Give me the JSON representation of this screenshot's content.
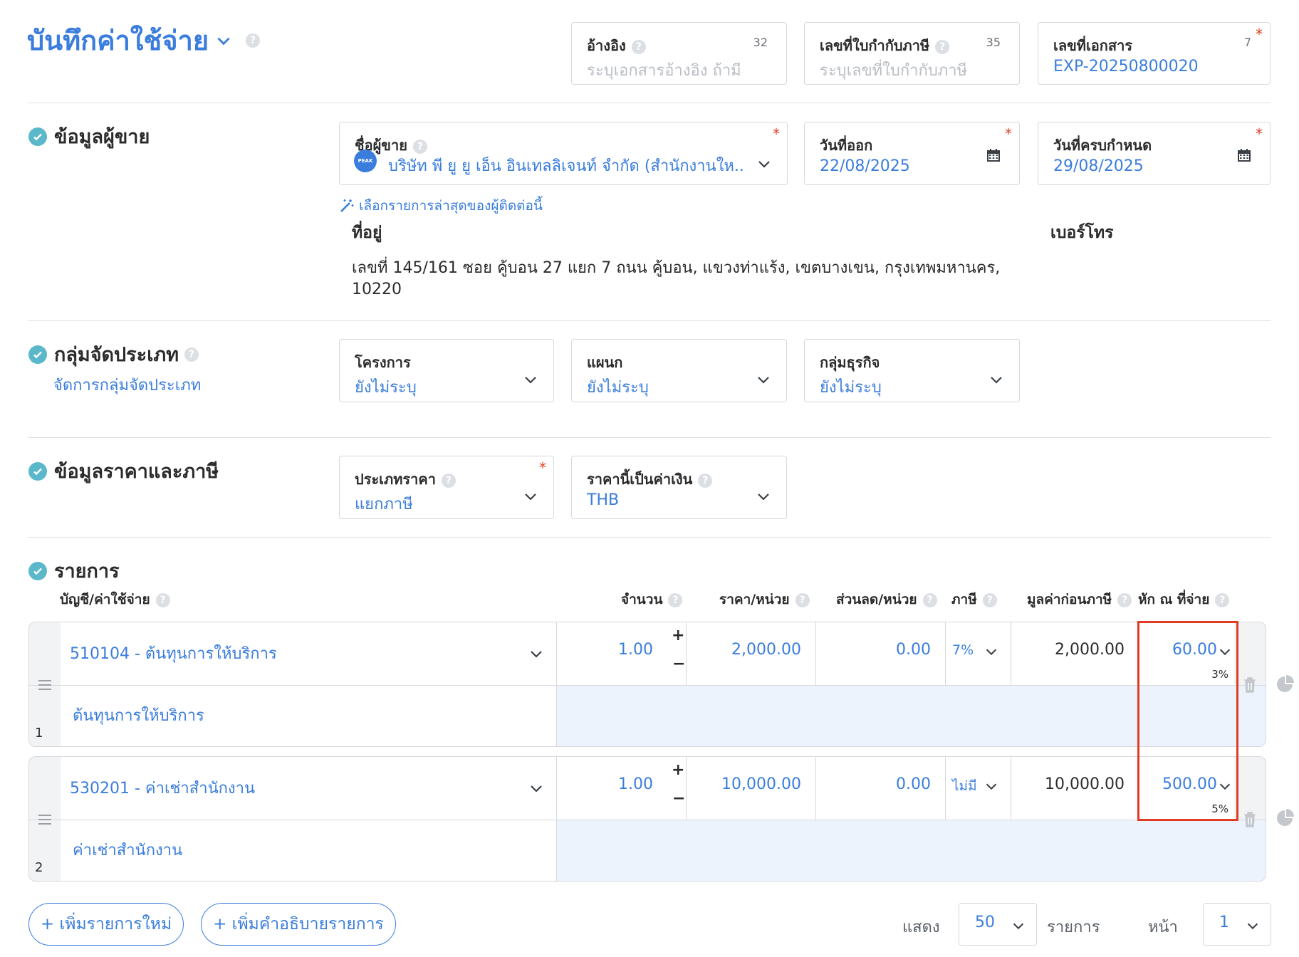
{
  "header": {
    "title": "บันทึกค่าใช้จ่าย",
    "fields": {
      "reference": {
        "label": "อ้างอิง",
        "count": "32",
        "placeholder": "ระบุเอกสารอ้างอิง ถ้ามี"
      },
      "tax_invoice": {
        "label": "เลขที่ใบกำกับภาษี",
        "count": "35",
        "placeholder": "ระบุเลขที่ใบกำกับภาษี"
      },
      "doc_number": {
        "label": "เลขที่เอกสาร",
        "count": "7",
        "value": "EXP-20250800020"
      }
    }
  },
  "vendor_section": {
    "title": "ข้อมูลผู้ขาย",
    "vendor_name": {
      "label": "ชื่อผู้ขาย",
      "value": "บริษัท พี ยู ยู เอ็น อินเทลลิเจนท์ จำกัด (สำนักงานให...",
      "avatar_text": "PEAK"
    },
    "issue_date": {
      "label": "วันที่ออก",
      "value": "22/08/2025"
    },
    "due_date": {
      "label": "วันที่ครบกำหนด",
      "value": "29/08/2025"
    },
    "latest_link": "เลือกรายการล่าสุดของผู้ติดต่อนี้",
    "address_label": "ที่อยู่",
    "address_line1": "เลขที่ 145/161 ซอย คู้บอน 27 แยก 7 ถนน คู้บอน, แขวงท่าแร้ง, เขตบางเขน, กรุงเทพมหานคร,",
    "address_line2": "10220",
    "phone_label": "เบอร์โทร"
  },
  "category_section": {
    "title": "กลุ่มจัดประเภท",
    "manage_link": "จัดการกลุ่มจัดประเภท",
    "project": {
      "label": "โครงการ",
      "value": "ยังไม่ระบุ"
    },
    "department": {
      "label": "แผนก",
      "value": "ยังไม่ระบุ"
    },
    "business_group": {
      "label": "กลุ่มธุรกิจ",
      "value": "ยังไม่ระบุ"
    }
  },
  "price_section": {
    "title": "ข้อมูลราคาและภาษี",
    "price_type": {
      "label": "ประเภทราคา",
      "value": "แยกภาษี"
    },
    "currency": {
      "label": "ราคานี้เป็นค่าเงิน",
      "value": "THB"
    }
  },
  "items_section": {
    "title": "รายการ",
    "columns": {
      "account": "บัญชี/ค่าใช้จ่าย",
      "qty": "จำนวน",
      "price": "ราคา/หน่วย",
      "discount": "ส่วนลด/หน่วย",
      "tax": "ภาษี",
      "pretax": "มูลค่าก่อนภาษี",
      "wht": "หัก ณ ที่จ่าย"
    },
    "rows": [
      {
        "number": "1",
        "account": "510104 - ต้นทุนการให้บริการ",
        "description": "ต้นทุนการให้บริการ",
        "qty": "1.00",
        "price": "2,000.00",
        "discount": "0.00",
        "tax": "7%",
        "pretax": "2,000.00",
        "wht": "60.00",
        "wht_rate": "3%"
      },
      {
        "number": "2",
        "account": "530201 - ค่าเช่าสำนักงาน",
        "description": "ค่าเช่าสำนักงาน",
        "qty": "1.00",
        "price": "10,000.00",
        "discount": "0.00",
        "tax": "ไม่มี",
        "pretax": "10,000.00",
        "wht": "500.00",
        "wht_rate": "5%"
      }
    ]
  },
  "footer": {
    "add_item": "+ เพิ่มรายการใหม่",
    "add_description": "+ เพิ่มคำอธิบายรายการ",
    "show_label": "แสดง",
    "page_size": "50",
    "items_label": "รายการ",
    "page_label": "หน้า",
    "page": "1"
  },
  "colors": {
    "accent": "#3a7ddd",
    "check": "#5ab8ca",
    "highlight": "#e03b24"
  }
}
